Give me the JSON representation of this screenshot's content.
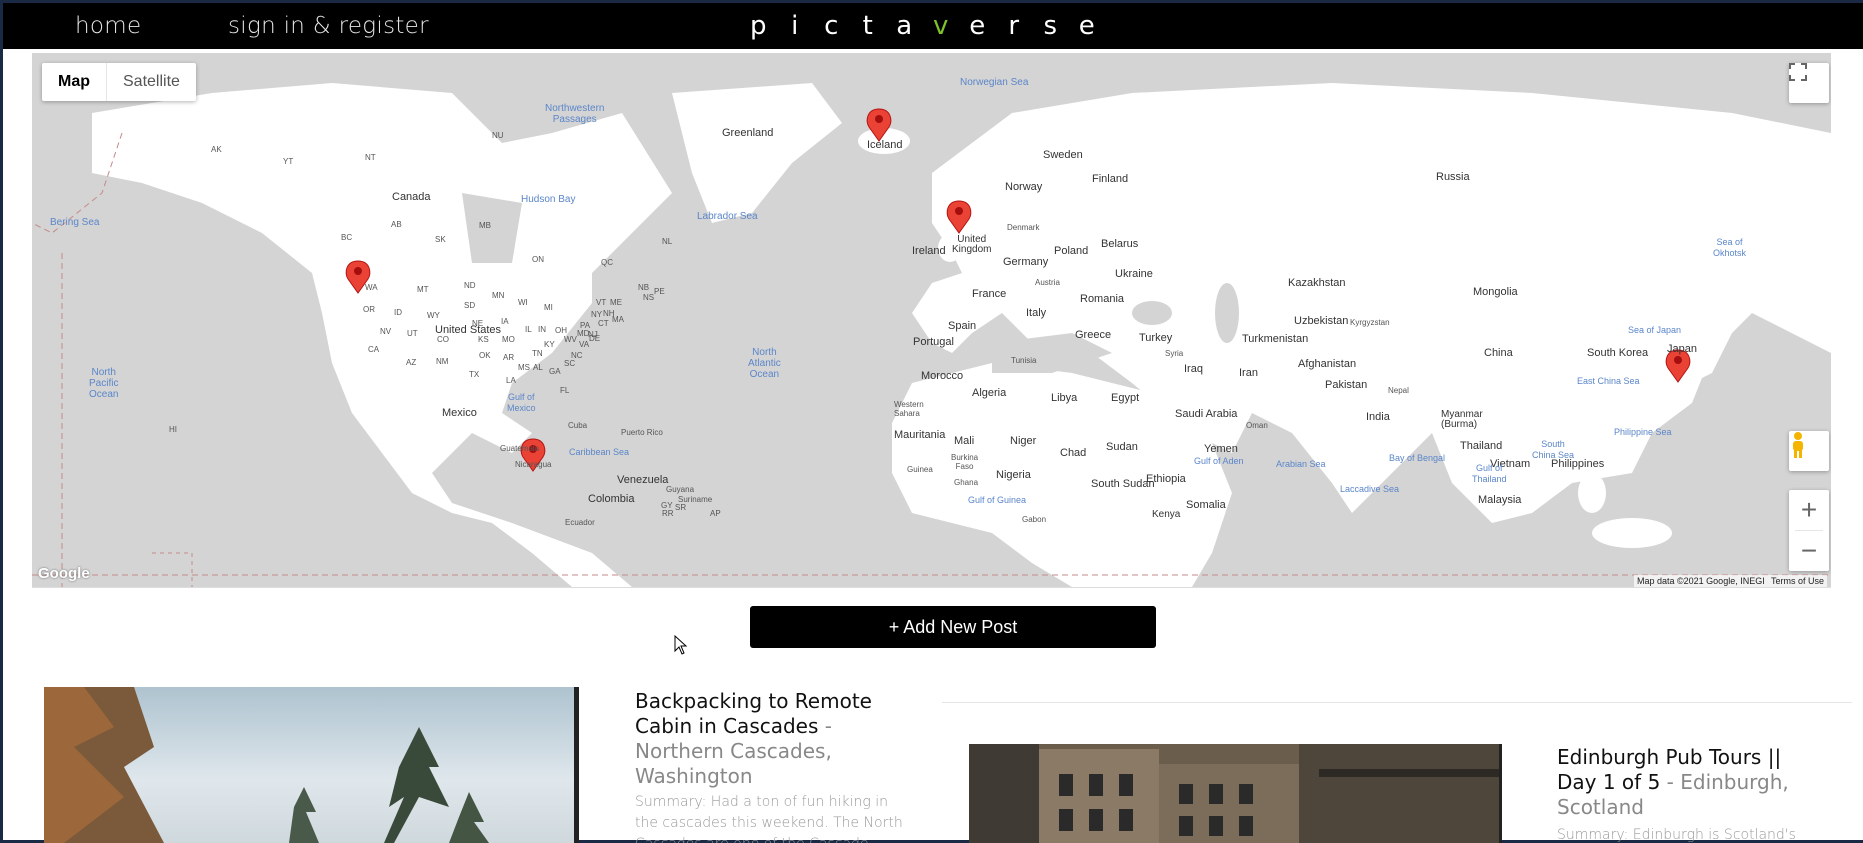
{
  "nav": {
    "home": "home",
    "signin": "sign in & register"
  },
  "logo": {
    "letters": [
      "p",
      "i",
      "c",
      "t",
      "a",
      "v",
      "e",
      "r",
      "s",
      "e"
    ],
    "accent_index": 5,
    "accent_color": "#7ec22a"
  },
  "map": {
    "type_map": "Map",
    "type_satellite": "Satellite",
    "google": "Google",
    "attribution": "Map data ©2021 Google, INEGI",
    "terms": "Terms of Use",
    "labels": {
      "greenland": "Greenland",
      "iceland": "Iceland",
      "russia": "Russia",
      "canada": "Canada",
      "sweden": "Sweden",
      "norway": "Norway",
      "finland": "Finland",
      "uk": "United\nKingdom",
      "ireland": "Ireland",
      "denmark": "Denmark",
      "poland": "Poland",
      "belarus": "Belarus",
      "germany": "Germany",
      "ukraine": "Ukraine",
      "france": "France",
      "austria": "Austria",
      "romania": "Romania",
      "kazakhstan": "Kazakhstan",
      "mongolia": "Mongolia",
      "spain": "Spain",
      "italy": "Italy",
      "portugal": "Portugal",
      "greece": "Greece",
      "turkey": "Turkey",
      "turkmenistan": "Turkmenistan",
      "uzbekistan": "Uzbekistan",
      "kyrgyzstan": "Kyrgyzstan",
      "china": "China",
      "south_korea": "South Korea",
      "japan": "Japan",
      "tunisia": "Tunisia",
      "syria": "Syria",
      "iraq": "Iraq",
      "iran": "Iran",
      "afghanistan": "Afghanistan",
      "pakistan": "Pakistan",
      "morocco": "Morocco",
      "algeria": "Algeria",
      "libya": "Libya",
      "egypt": "Egypt",
      "nepal": "Nepal",
      "saudi": "Saudi Arabia",
      "india": "India",
      "myanmar": "Myanmar\n(Burma)",
      "western_sahara": "Western\nSahara",
      "oman": "Oman",
      "thailand": "Thailand",
      "mauritania": "Mauritania",
      "mali": "Mali",
      "niger": "Niger",
      "chad": "Chad",
      "sudan": "Sudan",
      "yemen": "Yemen",
      "vietnam": "Vietnam",
      "philippines": "Philippines",
      "burkina": "Burkina\nFaso",
      "guinea": "Guinea",
      "nigeria": "Nigeria",
      "ghana": "Ghana",
      "south_sudan": "South Sudan",
      "ethiopia": "Ethiopia",
      "somalia": "Somalia",
      "malaysia": "Malaysia",
      "kenya": "Kenya",
      "gabon": "Gabon",
      "united_states": "United States",
      "mexico": "Mexico",
      "cuba": "Cuba",
      "puerto_rico": "Puerto Rico",
      "guatemala": "Guatemala",
      "nicaragua": "Nicaragua",
      "venezuela": "Venezuela",
      "colombia": "Colombia",
      "guyana": "Guyana",
      "suriname": "Suriname",
      "ecuador": "Ecuador"
    },
    "water": {
      "norwegian_sea": "Norwegian Sea",
      "nw_passages": "Northwestern\nPassages",
      "hudson_bay": "Hudson Bay",
      "labrador_sea": "Labrador Sea",
      "bering_sea": "Bering Sea",
      "north_atlantic": "North\nAtlantic\nOcean",
      "north_pacific": "North\nPacific\nOcean",
      "sea_okhotsk": "Sea of\nOkhotsk",
      "sea_japan": "Sea of Japan",
      "east_china": "East China Sea",
      "philippine_sea": "Philippine Sea",
      "south_china": "South\nChina Sea",
      "bay_bengal": "Bay of Bengal",
      "arabian_sea": "Arabian Sea",
      "gulf_aden": "Gulf of Aden",
      "laccadive": "Laccadive Sea",
      "gulf_thailand": "Gulf of\nThailand",
      "gulf_guinea": "Gulf of Guinea",
      "caribbean": "Caribbean Sea",
      "gulf_mexico": "Gulf of\nMexico"
    },
    "states": [
      "AK",
      "YT",
      "NT",
      "NU",
      "BC",
      "AB",
      "SK",
      "MB",
      "ON",
      "QC",
      "NL",
      "WA",
      "MT",
      "ND",
      "MN",
      "OR",
      "ID",
      "WY",
      "SD",
      "WI",
      "MI",
      "NY",
      "NV",
      "UT",
      "CO",
      "KS",
      "MO",
      "IL",
      "IN",
      "OH",
      "PA",
      "CA",
      "AZ",
      "NM",
      "OK",
      "AR",
      "TN",
      "KY",
      "WV",
      "VA",
      "NC",
      "TX",
      "LA",
      "MS",
      "AL",
      "GA",
      "SC",
      "FL",
      "NE",
      "IA",
      "ME",
      "VT",
      "NH",
      "MA",
      "CT",
      "NJ",
      "DE",
      "MD",
      "NB",
      "NS",
      "PE",
      "HI",
      "GY",
      "SR",
      "RR",
      "AP"
    ]
  },
  "add_post": "+ Add New Post",
  "posts": [
    {
      "title": "Backpacking to Remote Cabin in Cascades",
      "sep": " - ",
      "location": "Northern Cascades, Washington",
      "summary": "Summary: Had a ton of fun hiking in the cascades this weekend. The North Cascades are one of the Cascade..."
    },
    {
      "title": "Edinburgh Pub Tours || Day 1 of 5",
      "sep": " - ",
      "location": "Edinburgh, Scotland",
      "summary": "Summary: Edinburgh is Scotland's capital..."
    }
  ]
}
